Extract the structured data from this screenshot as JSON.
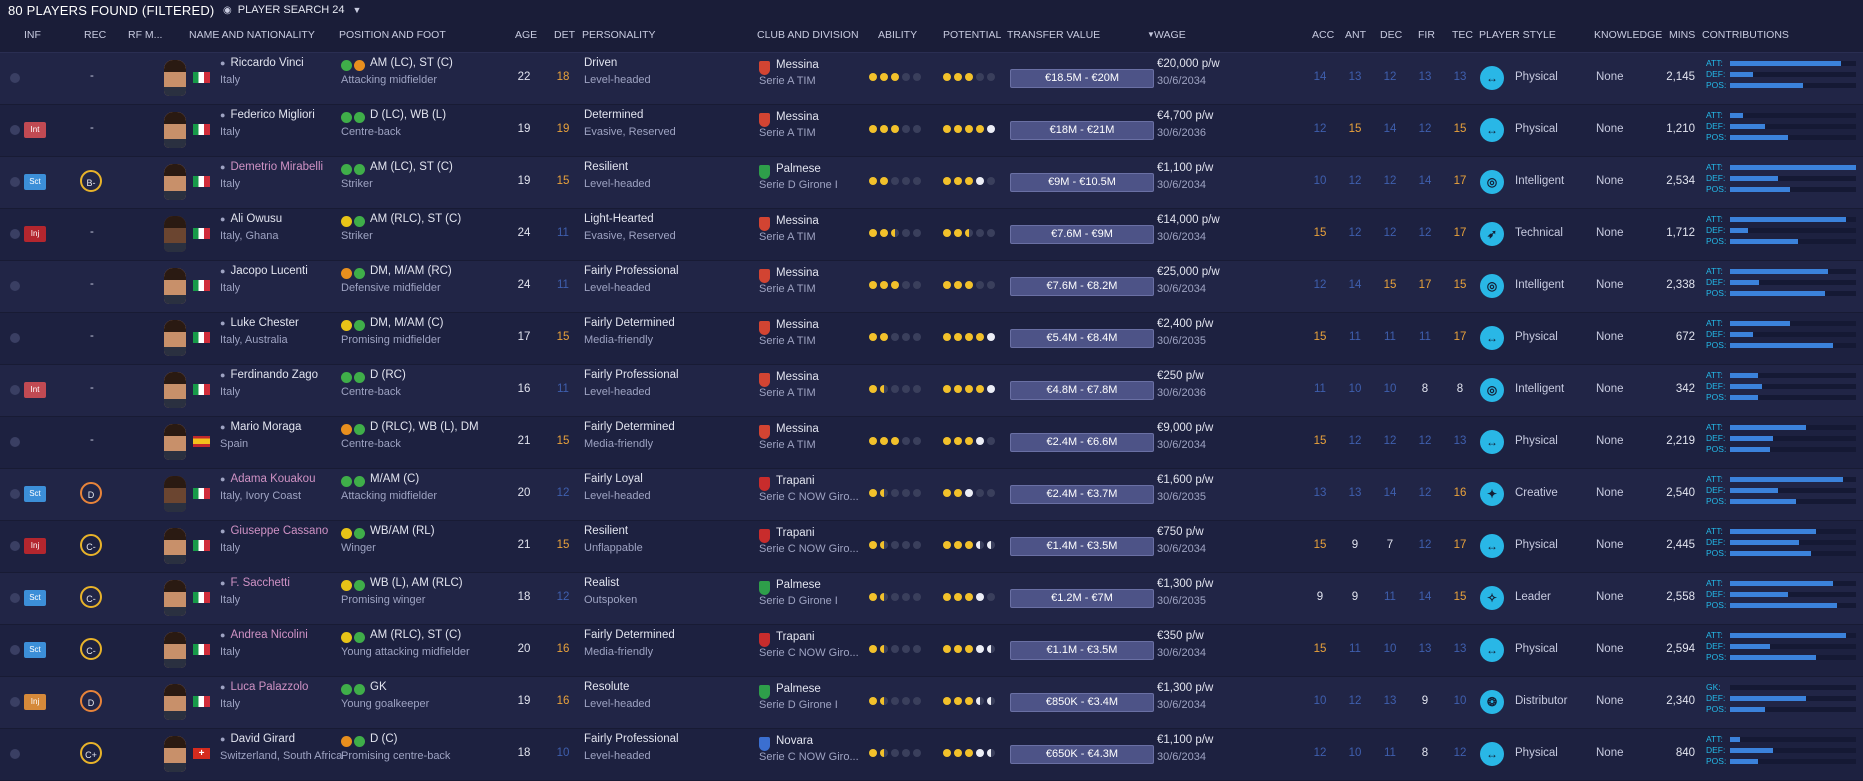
{
  "title": "80 PLAYERS FOUND (FILTERED)",
  "view_name": "PLAYER SEARCH 24",
  "headers": {
    "inf": "INF",
    "rec": "REC",
    "rfm": "RF M...",
    "name": "NAME AND NATIONALITY",
    "position": "POSITION AND FOOT",
    "age": "AGE",
    "det": "DET",
    "personality": "PERSONALITY",
    "club": "CLUB AND DIVISION",
    "ability": "ABILITY",
    "potential": "POTENTIAL",
    "transfer_value": "TRANSFER VALUE",
    "wage": "WAGE",
    "acc": "ACC",
    "ant": "ANT",
    "dec": "DEC",
    "fir": "FIR",
    "tec": "TEC",
    "player_style": "PLAYER STYLE",
    "knowledge": "KNOWLEDGE",
    "mins": "MINS",
    "contributions": "CONTRIBUTIONS"
  },
  "colors": {
    "attr_orange": "#e9a23b",
    "attr_blue": "#3f5fae",
    "attr_white": "#e2e4ef",
    "accent": "#29b7e6"
  },
  "players": [
    {
      "inf": "",
      "rec": "-",
      "name": "Riccardo Vinci",
      "name_pink": false,
      "nation": "Italy",
      "flag": "it",
      "feet": [
        "#3fae49",
        "#e88f1e"
      ],
      "pos": "AM (LC), ST (C)",
      "role": "Attacking midfielder",
      "age": "22",
      "det": "18",
      "det_c": "o",
      "pers1": "Driven",
      "pers2": "Level-headed",
      "club": "Messina",
      "crest": "#d24432",
      "div": "Serie A TIM",
      "ability": [
        "f",
        "f",
        "f",
        "e",
        "e"
      ],
      "potential": [
        "f",
        "f",
        "f",
        "e",
        "e"
      ],
      "tv": "€18.5M - €20M",
      "wage": "€20,000 p/w",
      "expiry": "30/6/2034",
      "acc": "14",
      "acc_c": "b",
      "ant": "13",
      "ant_c": "b",
      "dec": "12",
      "dec_c": "b",
      "fir": "13",
      "fir_c": "b",
      "tec": "13",
      "tec_c": "b",
      "style_icon": "↔",
      "style": "Physical",
      "knowledge": "None",
      "mins": "2,145",
      "contrib": [
        {
          "label": "ATT:",
          "value": 0.88
        },
        {
          "label": "DEF:",
          "value": 0.18
        },
        {
          "label": "POS:",
          "value": 0.58
        }
      ]
    },
    {
      "inf": "Int",
      "rec": "-",
      "name": "Federico Migliori",
      "name_pink": false,
      "nation": "Italy",
      "flag": "it",
      "feet": [
        "#3fae49",
        "#3fae49"
      ],
      "pos": "D (LC), WB (L)",
      "role": "Centre-back",
      "age": "19",
      "det": "19",
      "det_c": "o",
      "pers1": "Determined",
      "pers2": "Evasive, Reserved",
      "club": "Messina",
      "crest": "#d24432",
      "div": "Serie A TIM",
      "ability": [
        "f",
        "f",
        "f",
        "e",
        "e"
      ],
      "potential": [
        "f",
        "f",
        "f",
        "f",
        "w"
      ],
      "tv": "€18M - €21M",
      "wage": "€4,700 p/w",
      "expiry": "30/6/2036",
      "acc": "12",
      "acc_c": "b",
      "ant": "15",
      "ant_c": "o",
      "dec": "14",
      "dec_c": "b",
      "fir": "12",
      "fir_c": "b",
      "tec": "15",
      "tec_c": "o",
      "style_icon": "↔",
      "style": "Physical",
      "knowledge": "None",
      "mins": "1,210",
      "contrib": [
        {
          "label": "ATT:",
          "value": 0.1
        },
        {
          "label": "DEF:",
          "value": 0.28
        },
        {
          "label": "POS:",
          "value": 0.46
        }
      ]
    },
    {
      "inf": "Sct",
      "rec": "B-",
      "name": "Demetrio Mirabelli",
      "name_pink": true,
      "nation": "Italy",
      "flag": "it",
      "feet": [
        "#3fae49",
        "#3fae49"
      ],
      "pos": "AM (LC), ST (C)",
      "role": "Striker",
      "age": "19",
      "det": "15",
      "det_c": "o",
      "pers1": "Resilient",
      "pers2": "Level-headed",
      "club": "Palmese",
      "crest": "#2e9e4a",
      "div": "Serie D Girone I",
      "ability": [
        "f",
        "f",
        "e",
        "e",
        "e"
      ],
      "potential": [
        "f",
        "f",
        "f",
        "w",
        "e"
      ],
      "tv": "€9M - €10.5M",
      "wage": "€1,100 p/w",
      "expiry": "30/6/2034",
      "acc": "10",
      "acc_c": "b",
      "ant": "12",
      "ant_c": "b",
      "dec": "12",
      "dec_c": "b",
      "fir": "14",
      "fir_c": "b",
      "tec": "17",
      "tec_c": "o",
      "style_icon": "◎",
      "style": "Intelligent",
      "knowledge": "None",
      "mins": "2,534",
      "contrib": [
        {
          "label": "ATT:",
          "value": 1.0
        },
        {
          "label": "DEF:",
          "value": 0.38
        },
        {
          "label": "POS:",
          "value": 0.48
        }
      ]
    },
    {
      "inf": "Inj",
      "rec": "-",
      "name": "Ali Owusu",
      "name_pink": false,
      "nation": "Italy, Ghana",
      "flag": "it",
      "feet": [
        "#e8c417",
        "#3fae49"
      ],
      "pos": "AM (RLC), ST (C)",
      "role": "Striker",
      "age": "24",
      "det": "11",
      "det_c": "b",
      "pers1": "Light-Hearted",
      "pers2": "Evasive, Reserved",
      "club": "Messina",
      "crest": "#d24432",
      "div": "Serie A TIM",
      "ability": [
        "f",
        "f",
        "h",
        "e",
        "e"
      ],
      "potential": [
        "f",
        "f",
        "h",
        "e",
        "e"
      ],
      "tv": "€7.6M - €9M",
      "wage": "€14,000 p/w",
      "expiry": "30/6/2034",
      "acc": "15",
      "acc_c": "o",
      "ant": "12",
      "ant_c": "b",
      "dec": "12",
      "dec_c": "b",
      "fir": "12",
      "fir_c": "b",
      "tec": "17",
      "tec_c": "o",
      "style_icon": "➶",
      "style": "Technical",
      "knowledge": "None",
      "mins": "1,712",
      "contrib": [
        {
          "label": "ATT:",
          "value": 0.92
        },
        {
          "label": "DEF:",
          "value": 0.14
        },
        {
          "label": "POS:",
          "value": 0.54
        }
      ]
    },
    {
      "inf": "",
      "rec": "-",
      "name": "Jacopo Lucenti",
      "name_pink": false,
      "nation": "Italy",
      "flag": "it",
      "feet": [
        "#e88f1e",
        "#3fae49"
      ],
      "pos": "DM, M/AM (RC)",
      "role": "Defensive midfielder",
      "age": "24",
      "det": "11",
      "det_c": "b",
      "pers1": "Fairly Professional",
      "pers2": "Level-headed",
      "club": "Messina",
      "crest": "#d24432",
      "div": "Serie A TIM",
      "ability": [
        "f",
        "f",
        "f",
        "e",
        "e"
      ],
      "potential": [
        "f",
        "f",
        "f",
        "e",
        "e"
      ],
      "tv": "€7.6M - €8.2M",
      "wage": "€25,000 p/w",
      "expiry": "30/6/2034",
      "acc": "12",
      "acc_c": "b",
      "ant": "14",
      "ant_c": "b",
      "dec": "15",
      "dec_c": "o",
      "fir": "17",
      "fir_c": "o",
      "tec": "15",
      "tec_c": "o",
      "style_icon": "◎",
      "style": "Intelligent",
      "knowledge": "None",
      "mins": "2,338",
      "contrib": [
        {
          "label": "ATT:",
          "value": 0.78
        },
        {
          "label": "DEF:",
          "value": 0.23
        },
        {
          "label": "POS:",
          "value": 0.75
        }
      ]
    },
    {
      "inf": "",
      "rec": "-",
      "name": "Luke Chester",
      "name_pink": false,
      "nation": "Italy, Australia",
      "flag": "it",
      "feet": [
        "#e8c417",
        "#3fae49"
      ],
      "pos": "DM, M/AM (C)",
      "role": "Promising midfielder",
      "age": "17",
      "det": "15",
      "det_c": "o",
      "pers1": "Fairly Determined",
      "pers2": "Media-friendly",
      "club": "Messina",
      "crest": "#d24432",
      "div": "Serie A TIM",
      "ability": [
        "f",
        "f",
        "e",
        "e",
        "e"
      ],
      "potential": [
        "f",
        "f",
        "f",
        "f",
        "w"
      ],
      "tv": "€5.4M - €8.4M",
      "wage": "€2,400 p/w",
      "expiry": "30/6/2035",
      "acc": "15",
      "acc_c": "o",
      "ant": "11",
      "ant_c": "b",
      "dec": "11",
      "dec_c": "b",
      "fir": "11",
      "fir_c": "b",
      "tec": "17",
      "tec_c": "o",
      "style_icon": "↔",
      "style": "Physical",
      "knowledge": "None",
      "mins": "672",
      "contrib": [
        {
          "label": "ATT:",
          "value": 0.48
        },
        {
          "label": "DEF:",
          "value": 0.18
        },
        {
          "label": "POS:",
          "value": 0.82
        }
      ]
    },
    {
      "inf": "Int",
      "rec": "-",
      "name": "Ferdinando Zago",
      "name_pink": false,
      "nation": "Italy",
      "flag": "it",
      "feet": [
        "#3fae49",
        "#3fae49"
      ],
      "pos": "D (RC)",
      "role": "Centre-back",
      "age": "16",
      "det": "11",
      "det_c": "b",
      "pers1": "Fairly Professional",
      "pers2": "Level-headed",
      "club": "Messina",
      "crest": "#d24432",
      "div": "Serie A TIM",
      "ability": [
        "f",
        "h",
        "e",
        "e",
        "e"
      ],
      "potential": [
        "f",
        "f",
        "f",
        "f",
        "w"
      ],
      "tv": "€4.8M - €7.8M",
      "wage": "€250 p/w",
      "expiry": "30/6/2036",
      "acc": "11",
      "acc_c": "b",
      "ant": "10",
      "ant_c": "b",
      "dec": "10",
      "dec_c": "b",
      "fir": "8",
      "fir_c": "w",
      "tec": "8",
      "tec_c": "w",
      "style_icon": "◎",
      "style": "Intelligent",
      "knowledge": "None",
      "mins": "342",
      "contrib": [
        {
          "label": "ATT:",
          "value": 0.22
        },
        {
          "label": "DEF:",
          "value": 0.25
        },
        {
          "label": "POS:",
          "value": 0.22
        }
      ]
    },
    {
      "inf": "",
      "rec": "-",
      "name": "Mario Moraga",
      "name_pink": false,
      "nation": "Spain",
      "flag": "es",
      "feet": [
        "#e88f1e",
        "#3fae49"
      ],
      "pos": "D (RLC), WB (L), DM",
      "role": "Centre-back",
      "age": "21",
      "det": "15",
      "det_c": "o",
      "pers1": "Fairly Determined",
      "pers2": "Media-friendly",
      "club": "Messina",
      "crest": "#d24432",
      "div": "Serie A TIM",
      "ability": [
        "f",
        "f",
        "f",
        "e",
        "e"
      ],
      "potential": [
        "f",
        "f",
        "f",
        "w",
        "e"
      ],
      "tv": "€2.4M - €6.6M",
      "wage": "€9,000 p/w",
      "expiry": "30/6/2034",
      "acc": "15",
      "acc_c": "o",
      "ant": "12",
      "ant_c": "b",
      "dec": "12",
      "dec_c": "b",
      "fir": "12",
      "fir_c": "b",
      "tec": "13",
      "tec_c": "b",
      "style_icon": "↔",
      "style": "Physical",
      "knowledge": "None",
      "mins": "2,219",
      "contrib": [
        {
          "label": "ATT:",
          "value": 0.6
        },
        {
          "label": "DEF:",
          "value": 0.34
        },
        {
          "label": "POS:",
          "value": 0.32
        }
      ]
    },
    {
      "inf": "Sct",
      "rec": "D",
      "name": "Adama Kouakou",
      "name_pink": true,
      "nation": "Italy, Ivory Coast",
      "flag": "it",
      "feet": [
        "#3fae49",
        "#3fae49"
      ],
      "pos": "M/AM (C)",
      "role": "Attacking midfielder",
      "age": "20",
      "det": "12",
      "det_c": "b",
      "pers1": "Fairly Loyal",
      "pers2": "Level-headed",
      "club": "Trapani",
      "crest": "#c82c2c",
      "div": "Serie C NOW Giro...",
      "ability": [
        "f",
        "h",
        "e",
        "e",
        "e"
      ],
      "potential": [
        "f",
        "f",
        "w",
        "e",
        "e"
      ],
      "tv": "€2.4M - €3.7M",
      "wage": "€1,600 p/w",
      "expiry": "30/6/2035",
      "acc": "13",
      "acc_c": "b",
      "ant": "13",
      "ant_c": "b",
      "dec": "14",
      "dec_c": "b",
      "fir": "12",
      "fir_c": "b",
      "tec": "16",
      "tec_c": "o",
      "style_icon": "✦",
      "style": "Creative",
      "knowledge": "None",
      "mins": "2,540",
      "contrib": [
        {
          "label": "ATT:",
          "value": 0.9
        },
        {
          "label": "DEF:",
          "value": 0.38
        },
        {
          "label": "POS:",
          "value": 0.52
        }
      ]
    },
    {
      "inf": "Inj",
      "rec": "C-",
      "name": "Giuseppe Cassano",
      "name_pink": true,
      "nation": "Italy",
      "flag": "it",
      "feet": [
        "#e8c417",
        "#3fae49"
      ],
      "pos": "WB/AM (RL)",
      "role": "Winger",
      "age": "21",
      "det": "15",
      "det_c": "o",
      "pers1": "Resilient",
      "pers2": "Unflappable",
      "club": "Trapani",
      "crest": "#c82c2c",
      "div": "Serie C NOW Giro...",
      "ability": [
        "f",
        "h",
        "e",
        "e",
        "e"
      ],
      "potential": [
        "f",
        "f",
        "f",
        "halfw",
        "halfw"
      ],
      "tv": "€1.4M - €3.5M",
      "wage": "€750 p/w",
      "expiry": "30/6/2034",
      "acc": "15",
      "acc_c": "o",
      "ant": "9",
      "ant_c": "w",
      "dec": "7",
      "dec_c": "w",
      "fir": "12",
      "fir_c": "b",
      "tec": "17",
      "tec_c": "o",
      "style_icon": "↔",
      "style": "Physical",
      "knowledge": "None",
      "mins": "2,445",
      "contrib": [
        {
          "label": "ATT:",
          "value": 0.68
        },
        {
          "label": "DEF:",
          "value": 0.55
        },
        {
          "label": "POS:",
          "value": 0.64
        }
      ]
    },
    {
      "inf": "Sct",
      "rec": "C-",
      "name": "F. Sacchetti",
      "name_pink": true,
      "nation": "Italy",
      "flag": "it",
      "feet": [
        "#e8c417",
        "#3fae49"
      ],
      "pos": "WB (L), AM (RLC)",
      "role": "Promising winger",
      "age": "18",
      "det": "12",
      "det_c": "b",
      "pers1": "Realist",
      "pers2": "Outspoken",
      "club": "Palmese",
      "crest": "#2e9e4a",
      "div": "Serie D Girone I",
      "ability": [
        "f",
        "h",
        "e",
        "e",
        "e"
      ],
      "potential": [
        "f",
        "f",
        "f",
        "w",
        "e"
      ],
      "tv": "€1.2M - €7M",
      "wage": "€1,300 p/w",
      "expiry": "30/6/2035",
      "acc": "9",
      "acc_c": "w",
      "ant": "9",
      "ant_c": "w",
      "dec": "11",
      "dec_c": "b",
      "fir": "14",
      "fir_c": "b",
      "tec": "15",
      "tec_c": "o",
      "style_icon": "✧",
      "style": "Leader",
      "knowledge": "None",
      "mins": "2,558",
      "contrib": [
        {
          "label": "ATT:",
          "value": 0.82
        },
        {
          "label": "DEF:",
          "value": 0.46
        },
        {
          "label": "POS:",
          "value": 0.85
        }
      ]
    },
    {
      "inf": "Sct",
      "rec": "C-",
      "name": "Andrea Nicolini",
      "name_pink": true,
      "nation": "Italy",
      "flag": "it",
      "feet": [
        "#e8c417",
        "#3fae49"
      ],
      "pos": "AM (RLC), ST (C)",
      "role": "Young attacking midfielder",
      "age": "20",
      "det": "16",
      "det_c": "o",
      "pers1": "Fairly Determined",
      "pers2": "Media-friendly",
      "club": "Trapani",
      "crest": "#c82c2c",
      "div": "Serie C NOW Giro...",
      "ability": [
        "f",
        "h",
        "e",
        "e",
        "e"
      ],
      "potential": [
        "f",
        "f",
        "f",
        "w",
        "halfw"
      ],
      "tv": "€1.1M - €3.5M",
      "wage": "€350 p/w",
      "expiry": "30/6/2034",
      "acc": "15",
      "acc_c": "o",
      "ant": "11",
      "ant_c": "b",
      "dec": "10",
      "dec_c": "b",
      "fir": "13",
      "fir_c": "b",
      "tec": "13",
      "tec_c": "b",
      "style_icon": "↔",
      "style": "Physical",
      "knowledge": "None",
      "mins": "2,594",
      "contrib": [
        {
          "label": "ATT:",
          "value": 0.92
        },
        {
          "label": "DEF:",
          "value": 0.32
        },
        {
          "label": "POS:",
          "value": 0.68
        }
      ]
    },
    {
      "inf": "Inj",
      "rec": "D",
      "name": "Luca Palazzolo",
      "name_pink": true,
      "nation": "Italy",
      "flag": "it",
      "feet": [
        "#3fae49",
        "#3fae49"
      ],
      "pos": "GK",
      "role": "Young goalkeeper",
      "age": "19",
      "det": "16",
      "det_c": "o",
      "pers1": "Resolute",
      "pers2": "Level-headed",
      "club": "Palmese",
      "crest": "#2e9e4a",
      "div": "Serie D Girone I",
      "ability": [
        "f",
        "h",
        "e",
        "e",
        "e"
      ],
      "potential": [
        "f",
        "f",
        "f",
        "halfw",
        "halfw"
      ],
      "tv": "€850K - €3.4M",
      "wage": "€1,300 p/w",
      "expiry": "30/6/2034",
      "acc": "10",
      "acc_c": "b",
      "ant": "12",
      "ant_c": "b",
      "dec": "13",
      "dec_c": "b",
      "fir": "9",
      "fir_c": "w",
      "tec": "10",
      "tec_c": "b",
      "style_icon": "❂",
      "style": "Distributor",
      "knowledge": "None",
      "mins": "2,340",
      "contrib": [
        {
          "label": "GK:",
          "value": 0.0
        },
        {
          "label": "DEF:",
          "value": 0.6
        },
        {
          "label": "POS:",
          "value": 0.28
        }
      ]
    },
    {
      "inf": "",
      "rec": "C+",
      "name": "David Girard",
      "name_pink": false,
      "nation": "Switzerland, South Africa",
      "flag": "ch",
      "feet": [
        "#e88f1e",
        "#3fae49"
      ],
      "pos": "D (C)",
      "role": "Promising centre-back",
      "age": "18",
      "det": "10",
      "det_c": "b",
      "pers1": "Fairly Professional",
      "pers2": "Level-headed",
      "club": "Novara",
      "crest": "#3b6fd0",
      "div": "Serie C NOW Giro...",
      "ability": [
        "f",
        "h",
        "e",
        "e",
        "e"
      ],
      "potential": [
        "f",
        "f",
        "f",
        "w",
        "halfw"
      ],
      "tv": "€650K - €4.3M",
      "wage": "€1,100 p/w",
      "expiry": "30/6/2034",
      "acc": "12",
      "acc_c": "b",
      "ant": "10",
      "ant_c": "b",
      "dec": "11",
      "dec_c": "b",
      "fir": "8",
      "fir_c": "w",
      "tec": "12",
      "tec_c": "b",
      "style_icon": "↔",
      "style": "Physical",
      "knowledge": "None",
      "mins": "840",
      "contrib": [
        {
          "label": "ATT:",
          "value": 0.08
        },
        {
          "label": "DEF:",
          "value": 0.34
        },
        {
          "label": "POS:",
          "value": 0.22
        }
      ]
    }
  ]
}
